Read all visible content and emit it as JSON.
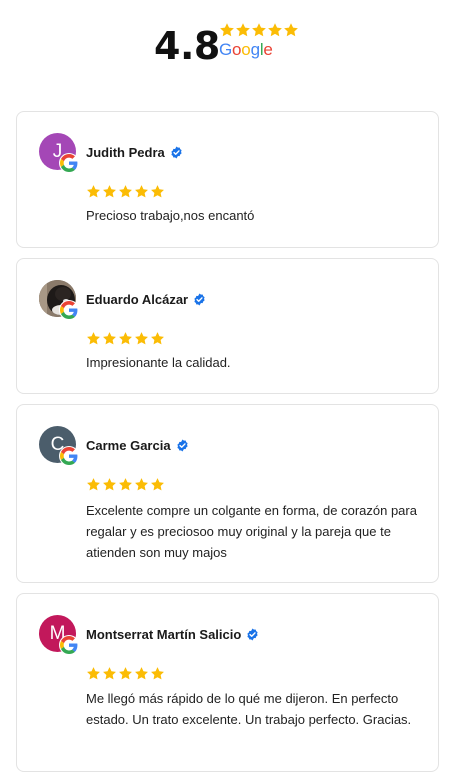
{
  "summary": {
    "rating": "4.8",
    "stars": 5,
    "provider": "Google",
    "star_color": "#FBBC05"
  },
  "reviews": [
    {
      "name": "Judith Pedra",
      "initial": "J",
      "avatar_color": "#A447B6",
      "avatar_kind": "initial",
      "verified": true,
      "stars": 5,
      "text": "Precioso trabajo,nos encantó"
    },
    {
      "name": "Eduardo Alcázar",
      "initial": "",
      "avatar_color": "#6b5a4a",
      "avatar_kind": "photo",
      "verified": true,
      "stars": 5,
      "text": "Impresionante la calidad."
    },
    {
      "name": "Carme Garcia",
      "initial": "C",
      "avatar_color": "#4B5D6B",
      "avatar_kind": "initial",
      "verified": true,
      "stars": 5,
      "text": "Excelente compre un colgante en forma, de corazón para regalar y es precioso​o muy original y la pareja que te atienden son muy majos"
    },
    {
      "name": "Montserrat Martín Salicio",
      "initial": "M",
      "avatar_color": "#C2185B",
      "avatar_kind": "initial",
      "verified": true,
      "stars": 5,
      "text": "Me llegó más rápido de lo qué me dijeron. En perfecto estado. Un trato excelente. Un trabajo perfecto. Gracias."
    }
  ],
  "icons": {
    "verified": "verified-check-icon",
    "google": "google-g-icon",
    "star": "star-icon"
  },
  "colors": {
    "verified_blue": "#1A73E8",
    "card_border": "#e3e3e3"
  }
}
